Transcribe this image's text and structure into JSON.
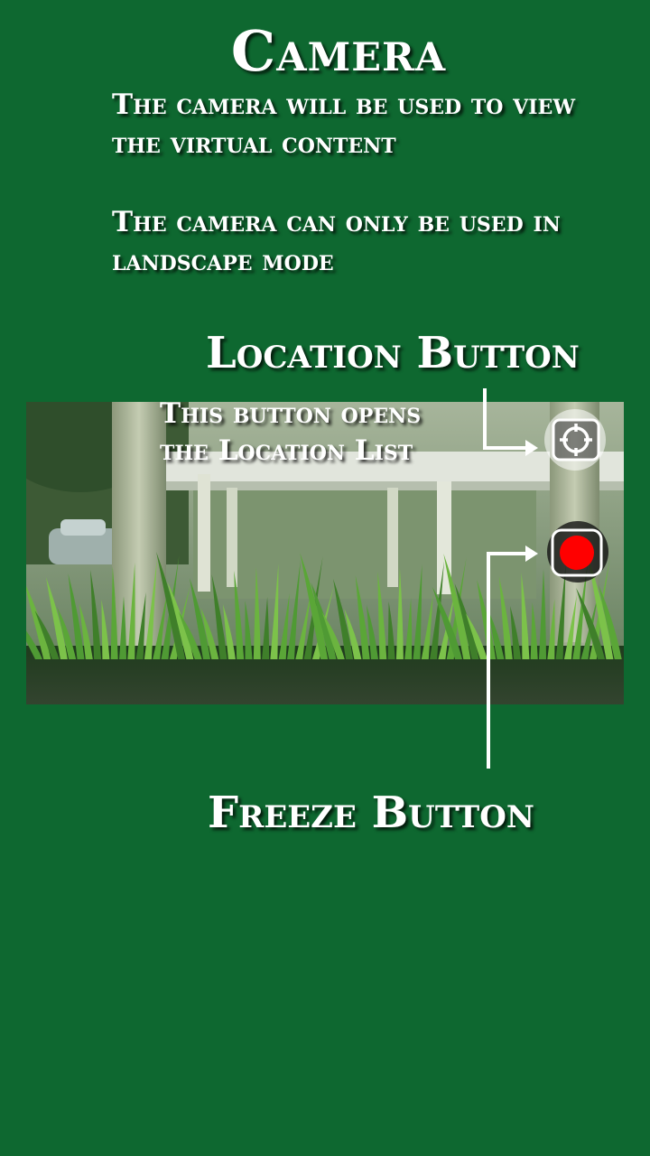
{
  "title": "Camera",
  "intro": {
    "line1": "The camera will be used to view the virtual content",
    "line2": "The camera can only be used in landscape mode"
  },
  "location": {
    "heading": "Location Button",
    "desc_line1": "This button opens",
    "desc_line2": "the Location List"
  },
  "freeze": {
    "heading": "Freeze Button"
  },
  "icons": {
    "location_button": "crosshair-target-icon",
    "freeze_button": "record-dot-icon"
  },
  "colors": {
    "background": "#0e6830",
    "text": "#ffffff",
    "freeze_dot": "#ff0000"
  }
}
